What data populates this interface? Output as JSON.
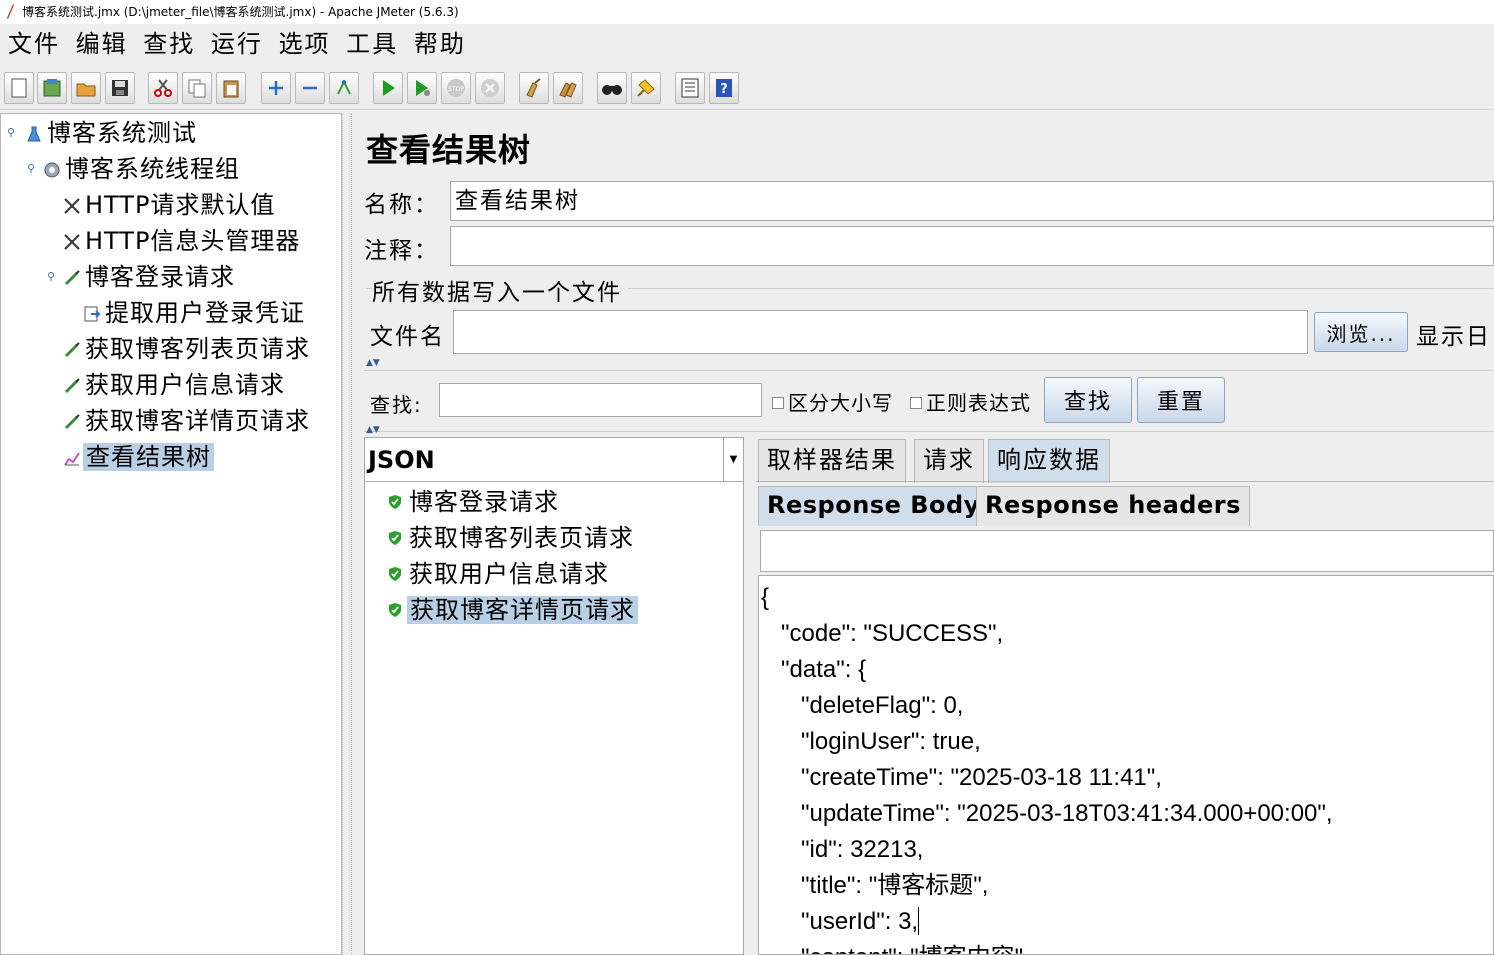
{
  "window": {
    "title": "博客系统测试.jmx (D:\\jmeter_file\\博客系统测试.jmx) - Apache JMeter (5.6.3)"
  },
  "menu": [
    "文件",
    "编辑",
    "查找",
    "运行",
    "选项",
    "工具",
    "帮助"
  ],
  "toolbar": {
    "icons": [
      "new-icon",
      "templates-icon",
      "open-icon",
      "save-icon",
      "cut-icon",
      "copy-icon",
      "paste-icon",
      "expand-icon",
      "collapse-icon",
      "toggle-icon",
      "start-icon",
      "start-no-pause-icon",
      "stop-icon",
      "shutdown-icon",
      "clear-icon",
      "clear-all-icon",
      "search-icon",
      "reset-search-icon",
      "function-helper-icon",
      "help-icon"
    ],
    "stop_text": "STOP"
  },
  "tree": {
    "items": [
      {
        "label": "博客系统测试",
        "icon": "test-plan-icon"
      },
      {
        "label": "博客系统线程组",
        "icon": "thread-group-icon"
      },
      {
        "label": "HTTP请求默认值",
        "icon": "config-tools-icon"
      },
      {
        "label": "HTTP信息头管理器",
        "icon": "config-tools-icon"
      },
      {
        "label": "博客登录请求",
        "icon": "sampler-pipette-icon"
      },
      {
        "label": "提取用户登录凭证",
        "icon": "extractor-icon"
      },
      {
        "label": "获取博客列表页请求",
        "icon": "sampler-pipette-icon"
      },
      {
        "label": "获取用户信息请求",
        "icon": "sampler-pipette-icon"
      },
      {
        "label": "获取博客详情页请求",
        "icon": "sampler-pipette-icon"
      },
      {
        "label": "查看结果树",
        "icon": "listener-graph-icon",
        "selected": true
      }
    ]
  },
  "panel": {
    "title": "查看结果树",
    "name_label": "名称：",
    "name_value": "查看结果树",
    "comment_label": "注释：",
    "comment_value": "",
    "file_group_title": "所有数据写入一个文件",
    "filename_label": "文件名",
    "filename_value": "",
    "browse_label": "浏览...",
    "display_log_label": "显示日"
  },
  "search": {
    "label": "查找:",
    "value": "",
    "case_sensitive": "区分大小写",
    "regex": "正则表达式",
    "find_button": "查找",
    "reset_button": "重置"
  },
  "renderer": {
    "selected": "JSON"
  },
  "results": [
    {
      "label": "博客登录请求",
      "status": "success"
    },
    {
      "label": "获取博客列表页请求",
      "status": "success"
    },
    {
      "label": "获取用户信息请求",
      "status": "success"
    },
    {
      "label": "获取博客详情页请求",
      "status": "success",
      "selected": true
    }
  ],
  "tabs": [
    "取样器结果",
    "请求",
    "响应数据"
  ],
  "active_tab": "响应数据",
  "subtabs": [
    "Response Body",
    "Response headers"
  ],
  "active_subtab": "Response Body",
  "response_lines": [
    "{",
    "   \"code\": \"SUCCESS\",",
    "   \"data\": {",
    "      \"deleteFlag\": 0,",
    "      \"loginUser\": true,",
    "      \"createTime\": \"2025-03-18 11:41\",",
    "      \"updateTime\": \"2025-03-18T03:41:34.000+00:00\",",
    "      \"id\": 32213,",
    "      \"title\": \"博客标题\",",
    "      \"userId\": 3,",
    "      \"content\": \"博客内容\","
  ],
  "colors": {
    "selection": "#b8cfe5",
    "tab_active": "#d0deec",
    "success": "#2e9e2e"
  }
}
